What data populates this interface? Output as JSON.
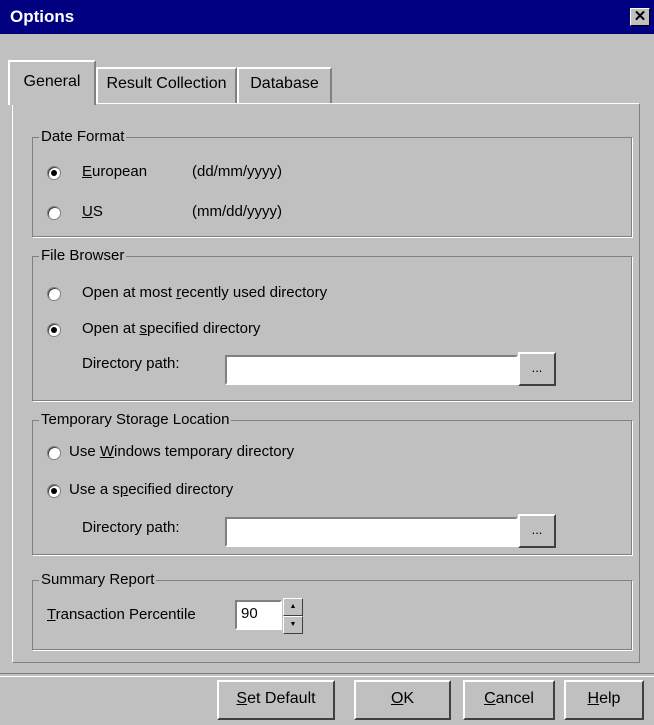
{
  "window": {
    "title": "Options"
  },
  "tabs": [
    {
      "label": "General",
      "active": true
    },
    {
      "label": "Result Collection",
      "active": false
    },
    {
      "label": "Database",
      "active": false
    }
  ],
  "date_format": {
    "legend": "Date Format",
    "options": [
      {
        "prefix": "",
        "mnemonic": "E",
        "rest": "uropean",
        "format": "(dd/mm/yyyy)",
        "selected": true
      },
      {
        "prefix": "",
        "mnemonic": "U",
        "rest": "S",
        "format": "(mm/dd/yyyy)",
        "selected": false
      }
    ]
  },
  "file_browser": {
    "legend": "File Browser",
    "options": [
      {
        "prefix": "Open at most ",
        "mnemonic": "r",
        "rest": "ecently used directory",
        "selected": false
      },
      {
        "prefix": "Open at ",
        "mnemonic": "s",
        "rest": "pecified directory",
        "selected": true
      }
    ],
    "path_label": "Directory  path:",
    "path_value": "",
    "browse_label": "..."
  },
  "temp_storage": {
    "legend": "Temporary Storage Location",
    "options": [
      {
        "prefix": "Use ",
        "mnemonic": "W",
        "rest": "indows temporary directory",
        "selected": false
      },
      {
        "prefix": "Use a s",
        "mnemonic": "p",
        "rest": "ecified directory",
        "selected": true
      }
    ],
    "path_label": "Directory  path:",
    "path_value": "",
    "browse_label": "..."
  },
  "summary_report": {
    "legend": "Summary Report",
    "percentile_mnemonic": "T",
    "percentile_rest": "ransaction Percentile",
    "percentile_value": "90"
  },
  "buttons": {
    "set_default": {
      "mnemonic": "S",
      "rest": "et Default"
    },
    "ok": {
      "mnemonic": "O",
      "rest": "K"
    },
    "cancel": {
      "mnemonic": "C",
      "rest": "ancel"
    },
    "help": {
      "mnemonic": "H",
      "rest": "elp"
    }
  },
  "icons": {
    "close": "close-icon",
    "spin_up": "spin-up-icon",
    "spin_down": "spin-down-icon"
  },
  "colors": {
    "titlebar": "#000080",
    "face": "#c0c0c0"
  }
}
